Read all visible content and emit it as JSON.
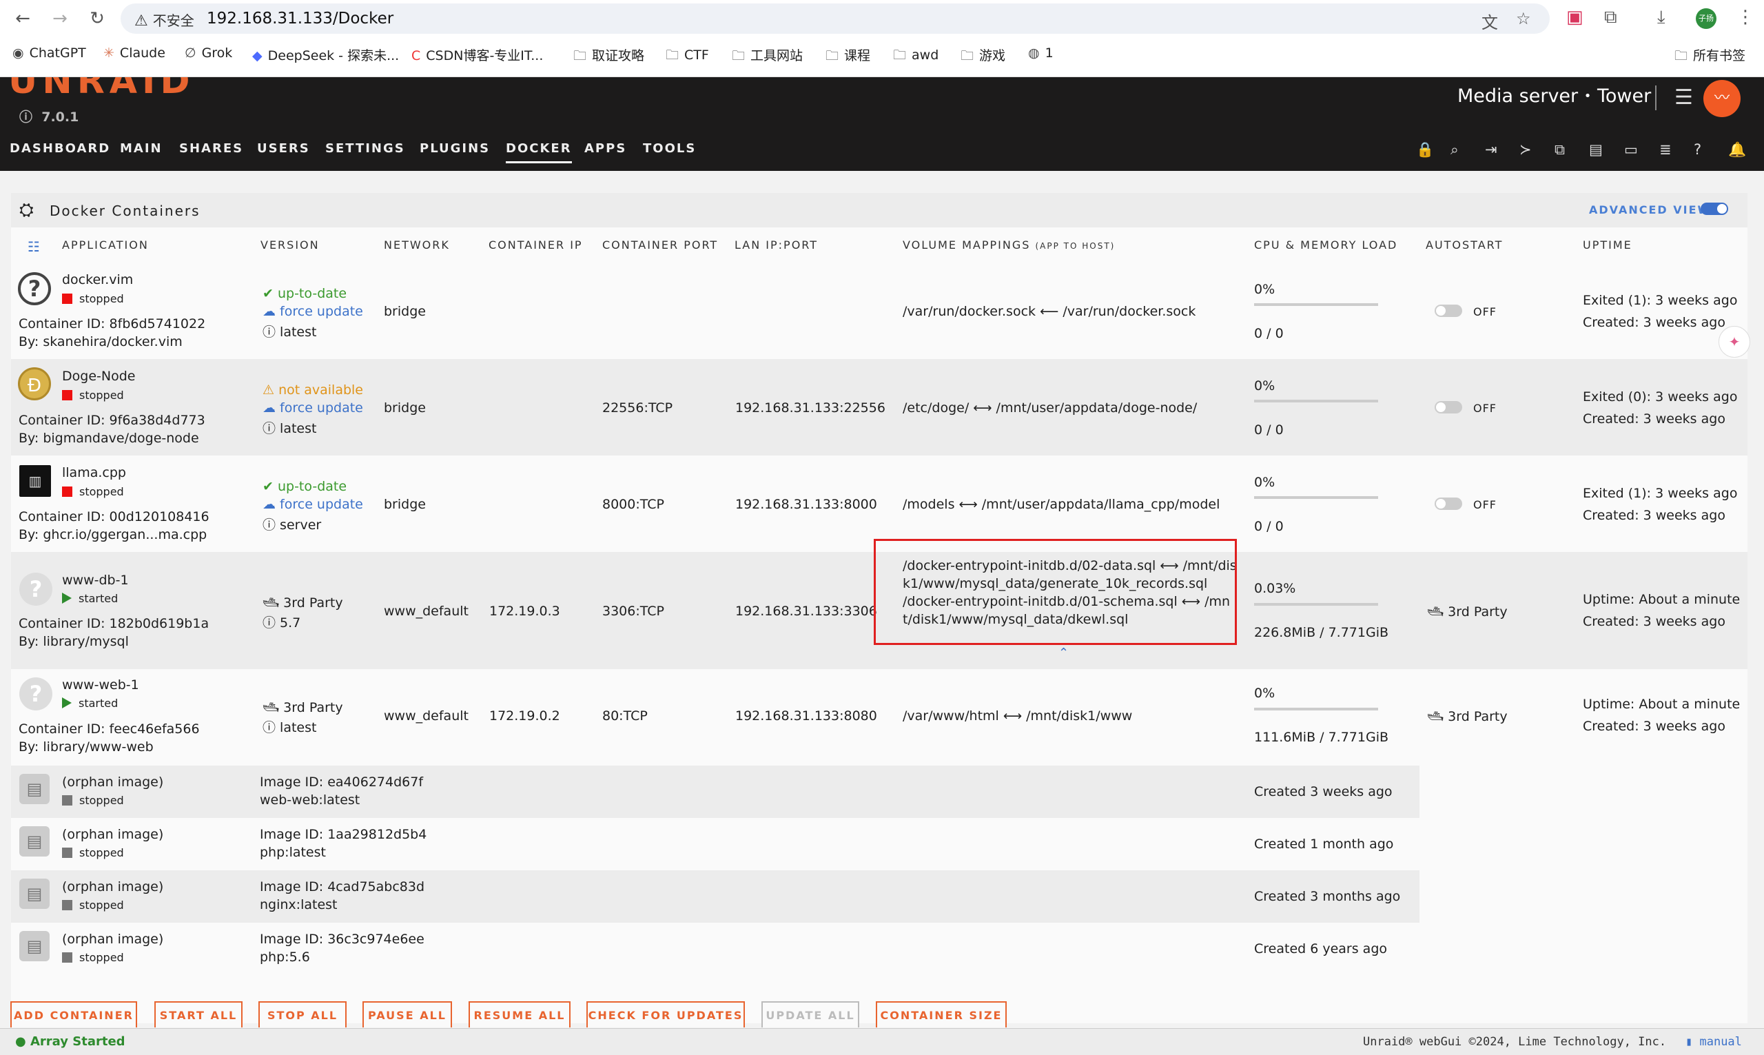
{
  "browser": {
    "warning": "不安全",
    "url": "192.168.31.133/Docker",
    "bookmarks": [
      "ChatGPT",
      "Claude",
      "Grok",
      "DeepSeek - 探索未...",
      "CSDN博客-专业IT...",
      "取证攻略",
      "CTF",
      "工具网站",
      "课程",
      "awd",
      "游戏",
      "1"
    ],
    "all_bookmarks": "所有书签",
    "avatar_text": "子扬"
  },
  "header": {
    "version": "7.0.1",
    "server_desc": "Media server",
    "bullet": "•",
    "server_name": "Tower",
    "logo": "UNRAID",
    "nav": [
      "DASHBOARD",
      "MAIN",
      "SHARES",
      "USERS",
      "SETTINGS",
      "PLUGINS",
      "DOCKER",
      "APPS",
      "TOOLS"
    ]
  },
  "panel": {
    "title": "Docker Containers",
    "advanced_view": "ADVANCED VIEW"
  },
  "columns": {
    "application": "APPLICATION",
    "version": "VERSION",
    "network": "NETWORK",
    "container_ip": "CONTAINER IP",
    "container_port": "CONTAINER PORT",
    "lan": "LAN IP:PORT",
    "volume": "VOLUME MAPPINGS",
    "volume_sub": "(APP TO HOST)",
    "cpu": "CPU & MEMORY LOAD",
    "autostart": "AUTOSTART",
    "uptime": "UPTIME"
  },
  "containers": [
    {
      "name": "docker.vim",
      "state": "stopped",
      "id": "Container ID: 8fb6d5741022",
      "by": "By: skanehira/docker.vim",
      "v1": "up-to-date",
      "v2": "force update",
      "v3": "latest",
      "network": "bridge",
      "cip": "",
      "cport": "",
      "lan": "",
      "vol": "/var/run/docker.sock ⟵ /var/run/docker.sock",
      "cpu": "0%",
      "mem": "0 / 0",
      "autostart": "OFF",
      "up1": "Exited (1): 3 weeks ago",
      "up2": "Created: 3 weeks ago"
    },
    {
      "name": "Doge-Node",
      "state": "stopped",
      "id": "Container ID: 9f6a38d4d773",
      "by": "By: bigmandave/doge-node",
      "v1": "not available",
      "v2": "force update",
      "v3": "latest",
      "network": "bridge",
      "cip": "",
      "cport": "22556:TCP",
      "lan": "192.168.31.133:22556",
      "vol": "/etc/doge/ ⟷ /mnt/user/appdata/doge-node/",
      "cpu": "0%",
      "mem": "0 / 0",
      "autostart": "OFF",
      "up1": "Exited (0): 3 weeks ago",
      "up2": "Created: 3 weeks ago"
    },
    {
      "name": "llama.cpp",
      "state": "stopped",
      "id": "Container ID: 00d120108416",
      "by": "By: ghcr.io/ggergan...ma.cpp",
      "v1": "up-to-date",
      "v2": "force update",
      "v3": "server",
      "network": "bridge",
      "cip": "",
      "cport": "8000:TCP",
      "lan": "192.168.31.133:8000",
      "vol": "/models ⟷ /mnt/user/appdata/llama_cpp/model",
      "cpu": "0%",
      "mem": "0 / 0",
      "autostart": "OFF",
      "up1": "Exited (1): 3 weeks ago",
      "up2": "Created: 3 weeks ago"
    },
    {
      "name": "www-db-1",
      "state": "started",
      "id": "Container ID: 182b0d619b1a",
      "by": "By: library/mysql",
      "v1": "3rd Party",
      "v3": "5.7",
      "network": "www_default",
      "cip": "172.19.0.3",
      "cport": "3306:TCP",
      "lan": "192.168.31.133:3306",
      "vol_lines": [
        "/docker-entrypoint-initdb.d/02-data.sql ⟷ /mnt/dis",
        "k1/www/mysql_data/generate_10k_records.sql",
        "/docker-entrypoint-initdb.d/01-schema.sql ⟷ /mn",
        "t/disk1/www/mysql_data/dkewl.sql"
      ],
      "cpu": "0.03%",
      "mem": "226.8MiB / 7.771GiB",
      "autostart": "3rd Party",
      "up1": "Uptime: About a minute",
      "up2": "Created: 3 weeks ago"
    },
    {
      "name": "www-web-1",
      "state": "started",
      "id": "Container ID: feec46efa566",
      "by": "By: library/www-web",
      "v1": "3rd Party",
      "v3": "latest",
      "network": "www_default",
      "cip": "172.19.0.2",
      "cport": "80:TCP",
      "lan": "192.168.31.133:8080",
      "vol": "/var/www/html ⟷ /mnt/disk1/www",
      "cpu": "0%",
      "mem": "111.6MiB / 7.771GiB",
      "autostart": "3rd Party",
      "up1": "Uptime: About a minute",
      "up2": "Created: 3 weeks ago"
    }
  ],
  "orphans": [
    {
      "name": "(orphan image)",
      "state": "stopped",
      "img": "Image ID: ea406274d67f",
      "tag": "web-web:latest",
      "created": "Created 3 weeks ago"
    },
    {
      "name": "(orphan image)",
      "state": "stopped",
      "img": "Image ID: 1aa29812d5b4",
      "tag": "php:latest",
      "created": "Created 1 month ago"
    },
    {
      "name": "(orphan image)",
      "state": "stopped",
      "img": "Image ID: 4cad75abc83d",
      "tag": "nginx:latest",
      "created": "Created 3 months ago"
    },
    {
      "name": "(orphan image)",
      "state": "stopped",
      "img": "Image ID: 36c3c974e6ee",
      "tag": "php:5.6",
      "created": "Created 6 years ago"
    }
  ],
  "buttons": [
    "ADD CONTAINER",
    "START ALL",
    "STOP ALL",
    "PAUSE ALL",
    "RESUME ALL",
    "CHECK FOR UPDATES",
    "UPDATE ALL",
    "CONTAINER SIZE"
  ],
  "footer": {
    "status": "Array Started",
    "copyright": "Unraid® webGui ©2024, Lime Technology, Inc.",
    "manual": "manual"
  }
}
